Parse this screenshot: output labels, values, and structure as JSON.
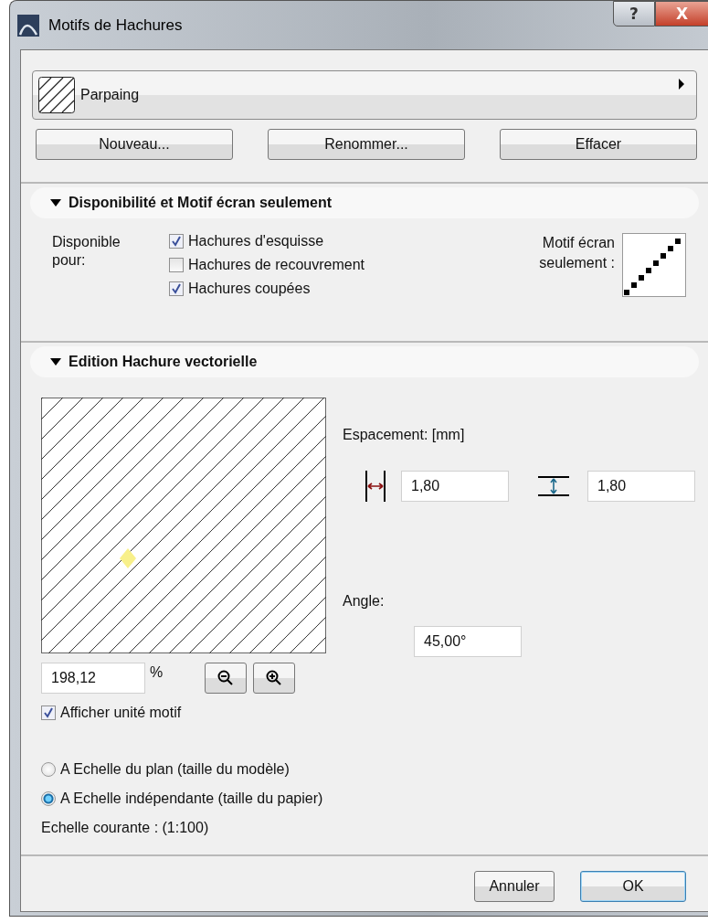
{
  "window": {
    "title": "Motifs de Hachures",
    "help_button": "?",
    "close_button": "X"
  },
  "pattern_selector": {
    "name": "Parpaing"
  },
  "pattern_buttons": [
    "Nouveau...",
    "Renommer...",
    "Effacer"
  ],
  "availability": {
    "header": "Disponibilité et Motif écran seulement",
    "expanded": true,
    "label": "Disponible pour:",
    "options": [
      {
        "label": "Hachures d'esquisse",
        "checked": true
      },
      {
        "label": "Hachures de recouvrement",
        "checked": false
      },
      {
        "label": "Hachures coupées",
        "checked": true
      }
    ],
    "screen_pattern_label": "Motif écran seulement :"
  },
  "vector_edit": {
    "header": "Edition Hachure vectorielle",
    "expanded": true,
    "zoom": "198,12",
    "zoom_unit": "%",
    "show_unit": {
      "label": "Afficher unité motif",
      "checked": true
    },
    "spacing_label": "Espacement: [mm]",
    "spacing_h": "1,80",
    "spacing_v": "1,80",
    "angle_label": "Angle:",
    "angle": "45,00°"
  },
  "scale_options": [
    {
      "label": "A Echelle du plan (taille du modèle)",
      "selected": false
    },
    {
      "label": "A Echelle indépendante (taille du papier)",
      "selected": true
    }
  ],
  "current_scale": "Echelle courante : (1:100)",
  "footer_buttons": [
    {
      "label": "Annuler",
      "default": false
    },
    {
      "label": "OK",
      "default": true
    }
  ]
}
